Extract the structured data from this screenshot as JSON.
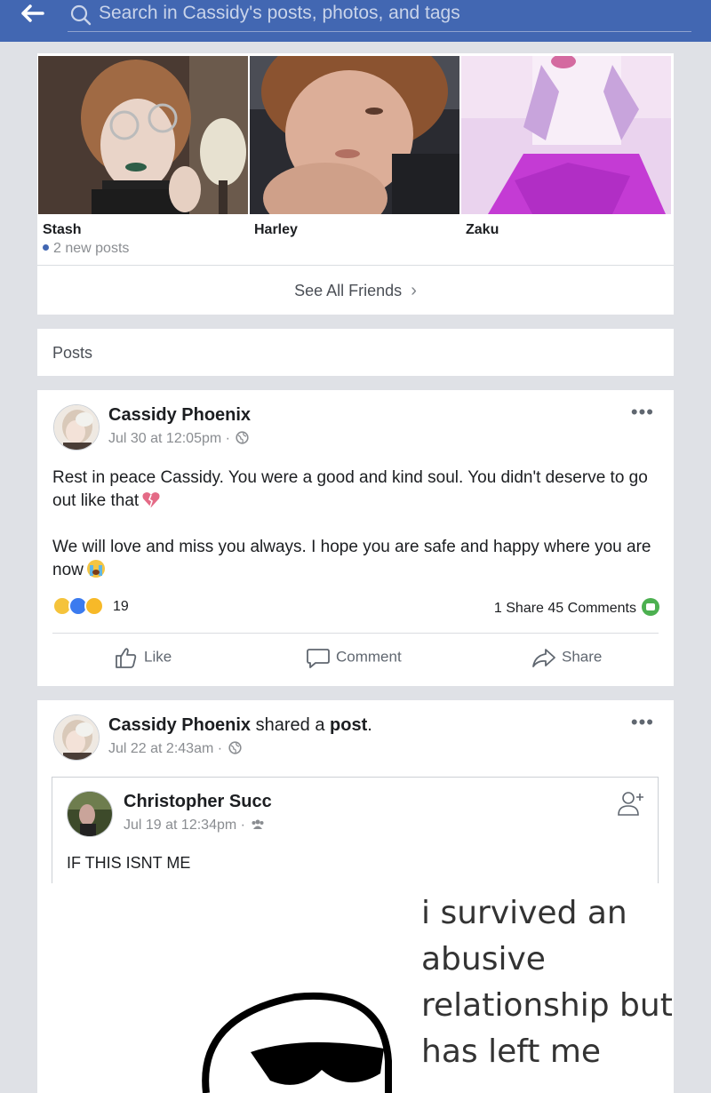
{
  "search": {
    "placeholder": "Search in Cassidy's posts, photos, and tags"
  },
  "friends": [
    {
      "name": "Stash",
      "status": "2 new posts"
    },
    {
      "name": "Harley",
      "status": ""
    },
    {
      "name": "Zaku",
      "status": ""
    }
  ],
  "see_all_label": "See All Friends",
  "posts_section_label": "Posts",
  "post1": {
    "author": "Cassidy Phoenix",
    "date": "Jul 30 at 12:05pm ·",
    "paragraph1": "Rest in peace Cassidy. You were a good and kind soul. You didn't deserve to go out like that",
    "paragraph2": "We will love and miss you always. I hope you are safe and happy where you are now",
    "reaction_count": "19",
    "shares": "1 Share",
    "comments": "45 Comments",
    "actions": {
      "like": "Like",
      "comment": "Comment",
      "share": "Share"
    }
  },
  "post2": {
    "author": "Cassidy Phoenix",
    "shared_text": " shared a ",
    "shared_obj": "post",
    "period": ".",
    "date": "Jul 22 at 2:43am ·",
    "original": {
      "author": "Christopher Succ",
      "date": "Jul 19 at 12:34pm ·",
      "text": "IF THIS ISNT ME"
    },
    "meme_lines": [
      "i survived an",
      "abusive",
      "relationship but i",
      "has left me"
    ]
  },
  "icons": {
    "back": "back-arrow-icon",
    "search": "search-icon",
    "globe": "globe-icon",
    "friends_audience": "friends-audience-icon",
    "more": "more-options-icon",
    "add_friend": "add-friend-icon"
  },
  "colors": {
    "header": "#4267b2",
    "background": "#dfe1e6",
    "comment_badge": "#4cb050"
  }
}
